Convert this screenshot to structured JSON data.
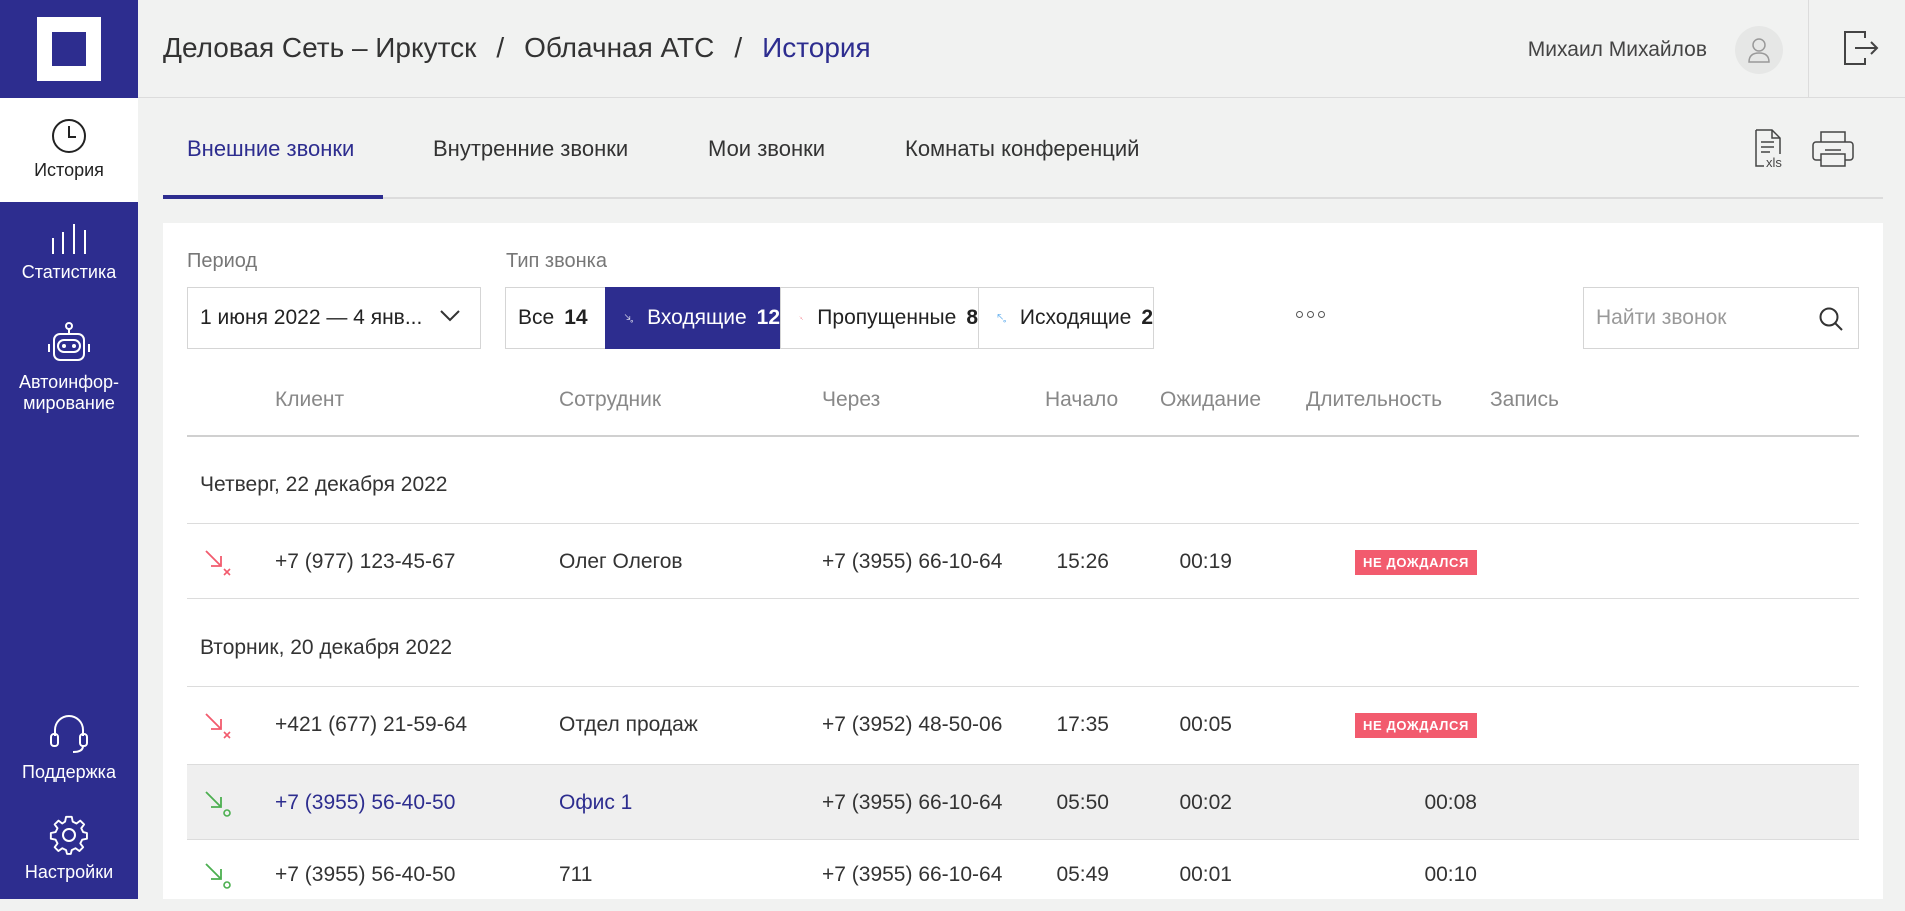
{
  "sidebar": {
    "items": [
      {
        "label": "История",
        "icon": "clock-icon"
      },
      {
        "label": "Статистика",
        "icon": "bars-icon"
      },
      {
        "label": "Автоинфор-\nмирование",
        "icon": "robot-icon"
      },
      {
        "label": "Поддержка",
        "icon": "headset-icon"
      },
      {
        "label": "Настройки",
        "icon": "gear-icon"
      }
    ]
  },
  "header": {
    "crumbs": [
      "Деловая Сеть – Иркутск",
      "/",
      "Облачная АТС",
      "/",
      "История"
    ],
    "user_name": "Михаил Михайлов"
  },
  "tabs": [
    "Внешние звонки",
    "Внутренние звонки",
    "Мои звонки",
    "Комнаты конференций"
  ],
  "tools": {
    "xls_label": "xls"
  },
  "filters": {
    "period_label": "Период",
    "period_value": "1 июня 2022 — 4 янв...",
    "type_label": "Тип звонка",
    "types": [
      {
        "label": "Все",
        "count": "14"
      },
      {
        "label": "Входящие",
        "count": "12"
      },
      {
        "label": "Пропущенные",
        "count": "8"
      },
      {
        "label": "Исходящие",
        "count": "2"
      }
    ],
    "search_placeholder": "Найти звонок"
  },
  "columns": [
    "Клиент",
    "Сотрудник",
    "Через",
    "Начало",
    "Ожидание",
    "Длительность",
    "Запись"
  ],
  "colors": {
    "accent": "#2d2d8f",
    "missed": "#f25b6e",
    "incoming": "#4caf50",
    "outgoing": "#3d9be9"
  },
  "groups": [
    {
      "date": "Четверг, 22 декабря 2022",
      "rows": [
        {
          "type": "missed",
          "client": "+7 (977) 123-45-67",
          "employee": "Олег Олегов",
          "via": "+7 (3955) 66-10-64",
          "start": "15:26",
          "wait": "00:19",
          "badge": "не дождался"
        }
      ]
    },
    {
      "date": "Вторник, 20 декабря 2022",
      "rows": [
        {
          "type": "missed",
          "client": "+421 (677) 21-59-64",
          "employee": "Отдел продаж",
          "via": "+7 (3952) 48-50-06",
          "start": "17:35",
          "wait": "00:05",
          "badge": "не дождался"
        },
        {
          "type": "incoming",
          "client": "+7 (3955) 56-40-50",
          "employee": "Офис 1",
          "via": "+7 (3955) 66-10-64",
          "start": "05:50",
          "wait": "00:02",
          "duration": "00:08"
        },
        {
          "type": "incoming",
          "client": "+7 (3955) 56-40-50",
          "employee": "711",
          "via": "+7 (3955) 66-10-64",
          "start": "05:49",
          "wait": "00:01",
          "duration": "00:10"
        }
      ]
    }
  ]
}
